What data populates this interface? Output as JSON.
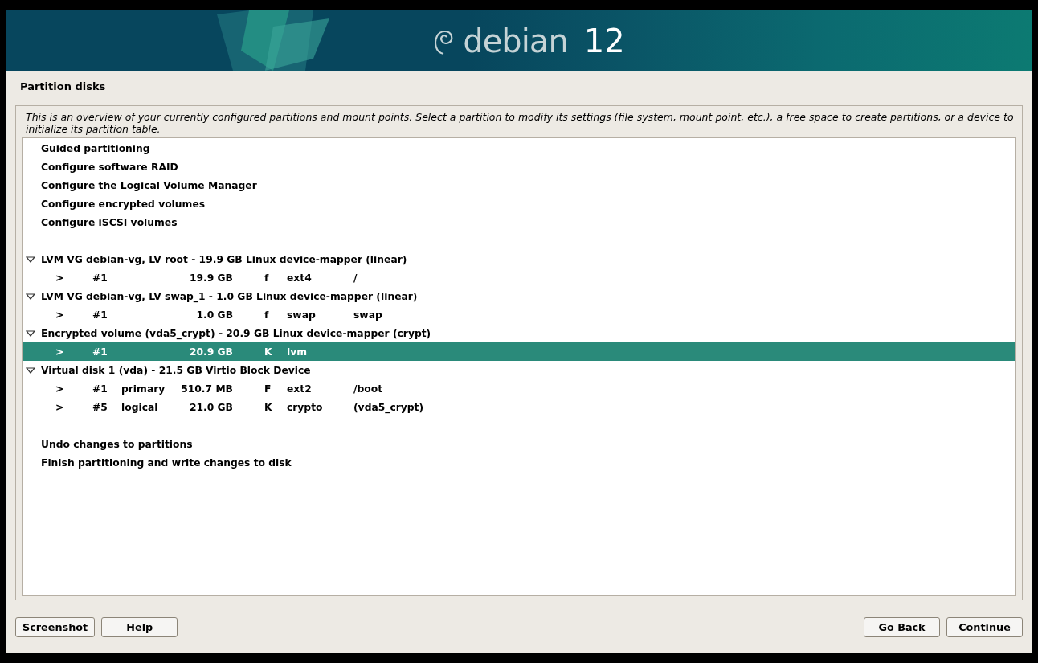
{
  "banner": {
    "logo_text": "debian",
    "version": "12"
  },
  "title": "Partition disks",
  "description": "This is an overview of your currently configured partitions and mount points. Select a partition to modify its settings (file system, mount point, etc.), a free space to create partitions, or a device to initialize its partition table.",
  "list": {
    "items": [
      {
        "kind": "action",
        "label": "Guided partitioning",
        "selected": false
      },
      {
        "kind": "action",
        "label": "Configure software RAID",
        "selected": false
      },
      {
        "kind": "action",
        "label": "Configure the Logical Volume Manager",
        "selected": false
      },
      {
        "kind": "action",
        "label": "Configure encrypted volumes",
        "selected": false
      },
      {
        "kind": "action",
        "label": "Configure iSCSI volumes",
        "selected": false
      },
      {
        "kind": "gap"
      },
      {
        "kind": "device",
        "label": "LVM VG debian-vg, LV root - 19.9 GB Linux device-mapper (linear)",
        "expanded": true,
        "selected": false,
        "children": [
          {
            "kind": "partition",
            "arrow": ">",
            "number": "#1",
            "size": "19.9 GB",
            "flag": "f",
            "fs": "ext4",
            "mount": "/",
            "selected": false
          }
        ]
      },
      {
        "kind": "device",
        "label": "LVM VG debian-vg, LV swap_1 - 1.0 GB Linux device-mapper (linear)",
        "expanded": true,
        "selected": false,
        "children": [
          {
            "kind": "partition",
            "arrow": ">",
            "number": "#1",
            "size": "1.0 GB",
            "flag": "f",
            "fs": "swap",
            "mount": "swap",
            "selected": false
          }
        ]
      },
      {
        "kind": "device",
        "label": "Encrypted volume (vda5_crypt) - 20.9 GB Linux device-mapper (crypt)",
        "expanded": true,
        "selected": false,
        "children": [
          {
            "kind": "partition",
            "arrow": ">",
            "number": "#1",
            "size": "20.9 GB",
            "flag": "K",
            "fs": "lvm",
            "selected": true
          }
        ]
      },
      {
        "kind": "device",
        "label": "Virtual disk 1 (vda) - 21.5 GB Virtio Block Device",
        "expanded": true,
        "selected": false,
        "children": [
          {
            "kind": "partition",
            "arrow": ">",
            "number": "#1",
            "type": "primary",
            "size": "510.7 MB",
            "flag": "F",
            "fs": "ext2",
            "mount": "/boot",
            "selected": false
          },
          {
            "kind": "partition",
            "arrow": ">",
            "number": "#5",
            "type": "logical",
            "size": "21.0 GB",
            "flag": "K",
            "fs": "crypto",
            "mount": "(vda5_crypt)",
            "selected": false
          }
        ]
      },
      {
        "kind": "gap"
      },
      {
        "kind": "action",
        "label": "Undo changes to partitions",
        "selected": false
      },
      {
        "kind": "action",
        "label": "Finish partitioning and write changes to disk",
        "selected": false
      }
    ]
  },
  "buttons_left": [
    "Screenshot",
    "Help"
  ],
  "buttons_right": [
    "Go Back",
    "Continue"
  ]
}
